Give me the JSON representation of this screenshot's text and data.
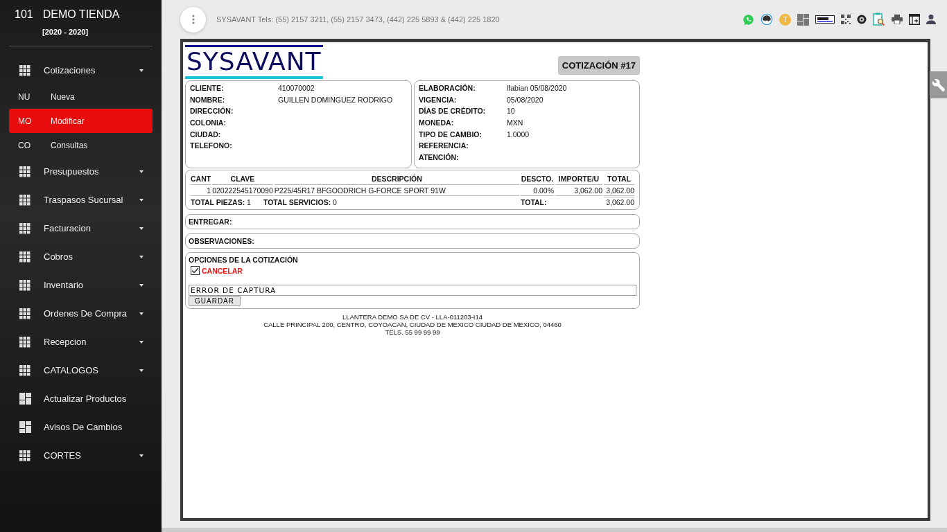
{
  "sidebar": {
    "store_number": "101",
    "store_name": "DEMO TIENDA",
    "period": "[2020 - 2020]",
    "items": [
      {
        "label": "Cotizaciones",
        "kind": "group",
        "children": [
          {
            "abbr": "NU",
            "label": "Nueva",
            "selected": false
          },
          {
            "abbr": "MO",
            "label": "Modificar",
            "selected": true
          },
          {
            "abbr": "CO",
            "label": "Consultas",
            "selected": false
          }
        ]
      },
      {
        "label": "Presupuestos",
        "kind": "group"
      },
      {
        "label": "Traspasos Sucursal",
        "kind": "group"
      },
      {
        "label": "Facturacion",
        "kind": "group"
      },
      {
        "label": "Cobros",
        "kind": "group"
      },
      {
        "label": "Inventario",
        "kind": "group"
      },
      {
        "label": "Ordenes De Compra",
        "kind": "group"
      },
      {
        "label": "Recepcion",
        "kind": "group"
      },
      {
        "label": "CATALOGOS",
        "kind": "group"
      },
      {
        "label": "Actualizar Productos",
        "kind": "link"
      },
      {
        "label": "Avisos De Cambios",
        "kind": "link"
      },
      {
        "label": "CORTES",
        "kind": "group"
      }
    ]
  },
  "header": {
    "text": "SYSAVANT Tels: (55) 2157 3211, (55) 2157 3473, (442) 225 5893 & (442) 225 1820",
    "user_initial": "T"
  },
  "document": {
    "logo": "SYSAVANT",
    "title": "COTIZACIÓN #17",
    "client_fields": [
      {
        "label": "CLIENTE:",
        "value": "410070002"
      },
      {
        "label": "NOMBRE:",
        "value": "GUILLEN DOMINGUEZ RODRIGO"
      },
      {
        "label": "DIRECCIÓN:"
      },
      {
        "label": "COLONIA:"
      },
      {
        "label": "CIUDAD:"
      },
      {
        "label": "TELEFONO:"
      }
    ],
    "quote_fields": [
      {
        "label": "ELABORACIÓN:",
        "value": "lfabian 05/08/2020"
      },
      {
        "label": "VIGENCIA:",
        "value": "05/08/2020"
      },
      {
        "label": "DÍAS DE CRÉDITO:",
        "value": "10"
      },
      {
        "label": "MONEDA:",
        "value": "MXN"
      },
      {
        "label": "TIPO DE CAMBIO:",
        "value": "1.0000"
      },
      {
        "label": "REFERENCIA:"
      },
      {
        "label": "ATENCIÓN:"
      }
    ],
    "table": {
      "columns": [
        "CANT",
        "CLAVE",
        "DESCRIPCIÓN",
        "DESCTO.",
        "IMPORTE/U",
        "TOTAL"
      ],
      "rows": [
        [
          "1",
          "020222545170090",
          "P225/45R17 BFGOODRICH G-FORCE SPORT 91W",
          "0.00%",
          "3,062.00",
          "3,062.00"
        ]
      ],
      "total_pieces": "**TOTAL PIEZAS:** 1",
      "total_services": "**TOTAL SERVICIOS:** 0",
      "total_label": "TOTAL:",
      "total_value": "3,062.00"
    },
    "deliver_label": "ENTREGAR:",
    "observations_label": "OBSERVACIONES:",
    "options": {
      "title": "OPCIONES DE LA COTIZACIÓN",
      "cancel_label": "CANCELAR",
      "cancel_checked": true,
      "reason": "ERROR DE CAPTURA",
      "save_button": "GUARDAR"
    },
    "footer": [
      "LLANTERA DEMO SA DE CV - LLA-011203-I14",
      "CALLE PRINCIPAL 200, CENTRO, COYOACAN, CIUDAD DE MEXICO CIUDAD DE MEXICO, 04460",
      "TELS. 55 99 99 99"
    ]
  }
}
